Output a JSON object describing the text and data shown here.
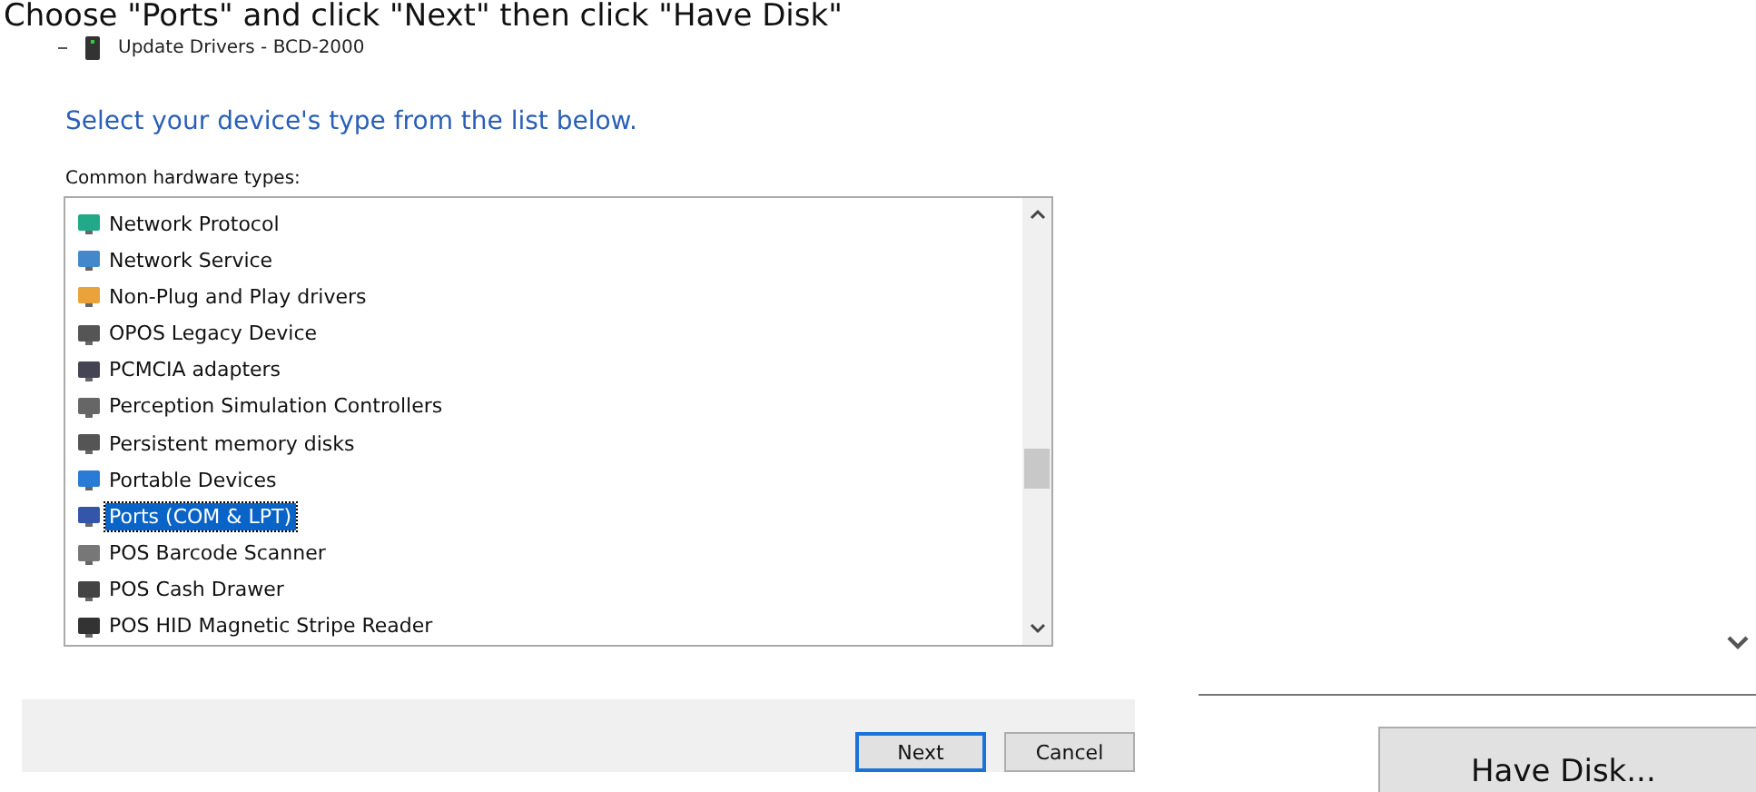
{
  "caption": "Choose \"Ports\" and click \"Next\" then click \"Have Disk\"",
  "window": {
    "title": "Update Drivers - BCD-2000"
  },
  "heading": "Select your device's type from the list below.",
  "list_label": "Common hardware types:",
  "items": [
    {
      "label": "Network Protocol",
      "selected": false
    },
    {
      "label": "Network Service",
      "selected": false
    },
    {
      "label": "Non-Plug and Play drivers",
      "selected": false
    },
    {
      "label": "OPOS Legacy Device",
      "selected": false
    },
    {
      "label": "PCMCIA adapters",
      "selected": false
    },
    {
      "label": "Perception Simulation Controllers",
      "selected": false
    },
    {
      "label": "Persistent memory disks",
      "selected": false
    },
    {
      "label": "Portable Devices",
      "selected": false
    },
    {
      "label": "Ports (COM & LPT)",
      "selected": true
    },
    {
      "label": "POS Barcode Scanner",
      "selected": false
    },
    {
      "label": "POS Cash Drawer",
      "selected": false
    },
    {
      "label": "POS HID Magnetic Stripe Reader",
      "selected": false
    }
  ],
  "buttons": [
    {
      "label": "Next",
      "focused": true
    },
    {
      "label": "Cancel",
      "focused": false
    }
  ],
  "side_button": "Have Disk..."
}
